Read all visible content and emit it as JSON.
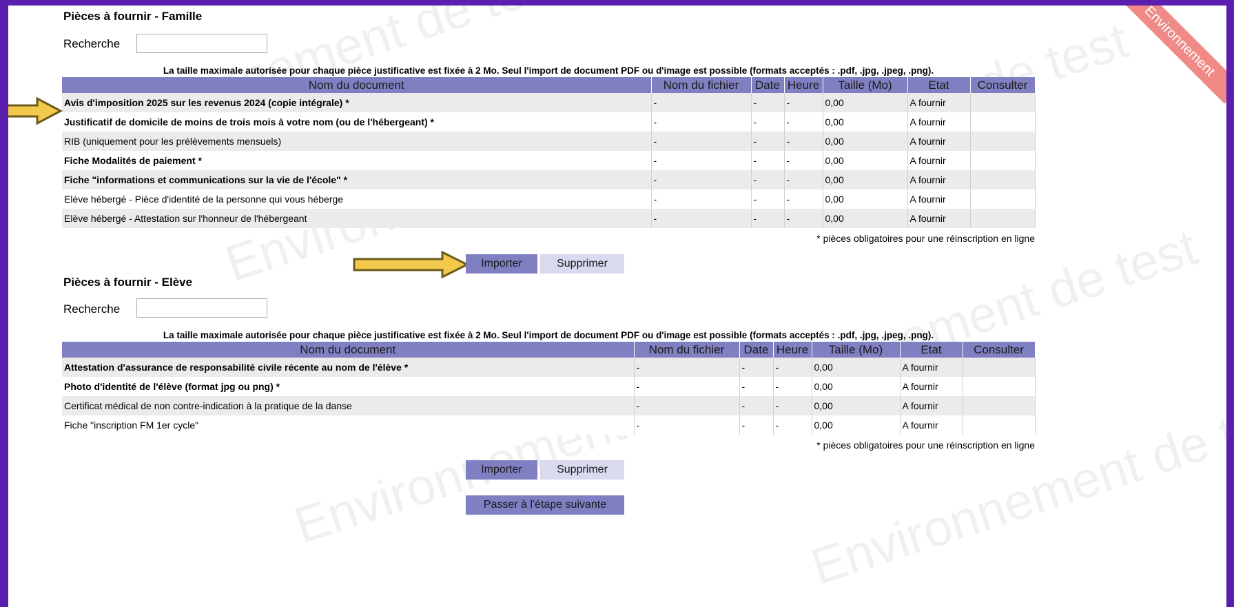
{
  "ribbon": "Environnement",
  "watermark_text": "Environnement de test",
  "famille": {
    "title": "Pièces à fournir - Famille",
    "search_label": "Recherche",
    "search_value": "",
    "notice": "La taille maximale autorisée pour chaque pièce justificative est fixée à 2 Mo. Seul l'import de document PDF ou d'image est possible (formats acceptés : .pdf, .jpg, .jpeg, .png).",
    "columns": [
      "Nom du document",
      "Nom du fichier",
      "Date",
      "Heure",
      "Taille (Mo)",
      "Etat",
      "Consulter"
    ],
    "rows": [
      {
        "name": "Avis d'imposition 2025 sur les revenus 2024 (copie intégrale) *",
        "file": "-",
        "date": "-",
        "time": "-",
        "size": "0,00",
        "state": "A fournir",
        "consult": ""
      },
      {
        "name": "Justificatif de domicile de moins de trois mois à votre nom (ou de l'hébergeant) *",
        "file": "-",
        "date": "-",
        "time": "-",
        "size": "0,00",
        "state": "A fournir",
        "consult": ""
      },
      {
        "name": "RIB (uniquement pour les prélèvements mensuels)",
        "file": "-",
        "date": "-",
        "time": "-",
        "size": "0,00",
        "state": "A fournir",
        "consult": ""
      },
      {
        "name": "Fiche Modalités de paiement *",
        "file": "-",
        "date": "-",
        "time": "-",
        "size": "0,00",
        "state": "A fournir",
        "consult": ""
      },
      {
        "name": "Fiche \"informations et communications sur la vie de l'école\" *",
        "file": "-",
        "date": "-",
        "time": "-",
        "size": "0,00",
        "state": "A fournir",
        "consult": ""
      },
      {
        "name": "Elève hébergé - Pièce d'identité de la personne qui vous héberge",
        "file": "-",
        "date": "-",
        "time": "-",
        "size": "0,00",
        "state": "A fournir",
        "consult": ""
      },
      {
        "name": "Elève hébergé - Attestation sur l'honneur de l'hébergeant",
        "file": "-",
        "date": "-",
        "time": "-",
        "size": "0,00",
        "state": "A fournir",
        "consult": ""
      }
    ],
    "footnote": "* pièces obligatoires pour une réinscription en ligne",
    "import_label": "Importer",
    "delete_label": "Supprimer"
  },
  "eleve": {
    "title": "Pièces à fournir - Elève",
    "search_label": "Recherche",
    "search_value": "",
    "notice": "La taille maximale autorisée pour chaque pièce justificative est fixée à 2 Mo. Seul l'import de document PDF ou d'image est possible (formats acceptés : .pdf, .jpg, .jpeg, .png).",
    "columns": [
      "Nom du document",
      "Nom du fichier",
      "Date",
      "Heure",
      "Taille (Mo)",
      "Etat",
      "Consulter"
    ],
    "rows": [
      {
        "name": "Attestation d'assurance de responsabilité civile récente au nom de l'élève *",
        "file": "-",
        "date": "-",
        "time": "-",
        "size": "0,00",
        "state": "A fournir",
        "consult": ""
      },
      {
        "name": "Photo d'identité de l'élève (format jpg ou png) *",
        "file": "-",
        "date": "-",
        "time": "-",
        "size": "0,00",
        "state": "A fournir",
        "consult": ""
      },
      {
        "name": "Certificat médical de non contre-indication à la pratique de la danse",
        "file": "-",
        "date": "-",
        "time": "-",
        "size": "0,00",
        "state": "A fournir",
        "consult": ""
      },
      {
        "name": "Fiche \"inscription FM 1er cycle\"",
        "file": "-",
        "date": "-",
        "time": "-",
        "size": "0,00",
        "state": "A fournir",
        "consult": ""
      }
    ],
    "footnote": "* pièces obligatoires pour une réinscription en ligne",
    "import_label": "Importer",
    "delete_label": "Supprimer"
  },
  "next_step_label": "Passer à l'étape suivante",
  "colors": {
    "frame_border": "#5b1fb0",
    "header_bg": "#7f7fc2",
    "primary_button": "#7f7fc2",
    "secondary_button": "#d9d9ef",
    "arrow_fill": "#f2c94c",
    "ribbon_bg": "#ef8a86"
  }
}
